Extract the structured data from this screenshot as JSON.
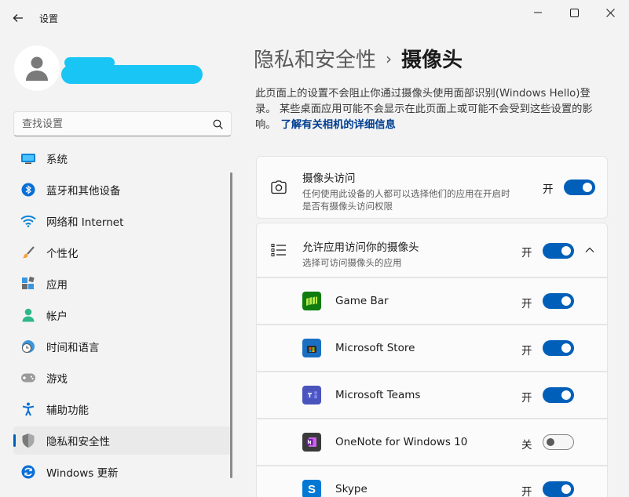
{
  "window": {
    "title": "设置"
  },
  "search": {
    "placeholder": "查找设置"
  },
  "nav": {
    "items": [
      {
        "label": "系统",
        "icon": "monitor-icon"
      },
      {
        "label": "蓝牙和其他设备",
        "icon": "bluetooth-icon"
      },
      {
        "label": "网络和 Internet",
        "icon": "wifi-icon"
      },
      {
        "label": "个性化",
        "icon": "brush-icon"
      },
      {
        "label": "应用",
        "icon": "apps-icon"
      },
      {
        "label": "帐户",
        "icon": "person-icon"
      },
      {
        "label": "时间和语言",
        "icon": "clock-globe-icon"
      },
      {
        "label": "游戏",
        "icon": "gamepad-icon"
      },
      {
        "label": "辅助功能",
        "icon": "accessibility-icon"
      },
      {
        "label": "隐私和安全性",
        "icon": "shield-icon",
        "active": true
      },
      {
        "label": "Windows 更新",
        "icon": "update-icon"
      }
    ]
  },
  "breadcrumb": {
    "parent": "隐私和安全性",
    "separator": "›",
    "current": "摄像头"
  },
  "description": {
    "text": "此页面上的设置不会阻止你通过摄像头使用面部识别(Windows Hello)登录。 某些桌面应用可能不会显示在此页面上或可能不会受到这些设置的影响。",
    "link": "了解有关相机的详细信息"
  },
  "camera_access": {
    "title": "摄像头访问",
    "subtitle_line1": "任何使用此设备的人都可以选择他们的应用在开启时",
    "subtitle_line2": "是否有摄像头访问权限",
    "state": "开",
    "on": true
  },
  "app_access": {
    "title": "允许应用访问你的摄像头",
    "subtitle": "选择可访问摄像头的应用",
    "state": "开",
    "on": true
  },
  "apps": [
    {
      "name": "Game Bar",
      "state": "开",
      "on": true,
      "icon": "game-bar-icon",
      "color": "#107c10"
    },
    {
      "name": "Microsoft Store",
      "state": "开",
      "on": true,
      "icon": "store-icon",
      "color": "#1b6fc2"
    },
    {
      "name": "Microsoft Teams",
      "state": "开",
      "on": true,
      "icon": "teams-icon",
      "color": "#4b53bc"
    },
    {
      "name": "OneNote for Windows 10",
      "state": "关",
      "on": false,
      "icon": "onenote-icon",
      "color": "#7719aa"
    },
    {
      "name": "Skype",
      "state": "开",
      "on": true,
      "icon": "skype-icon",
      "color": "#0078d4"
    }
  ],
  "colors": {
    "accent": "#005fb8",
    "redaction": "#19c5f4"
  }
}
